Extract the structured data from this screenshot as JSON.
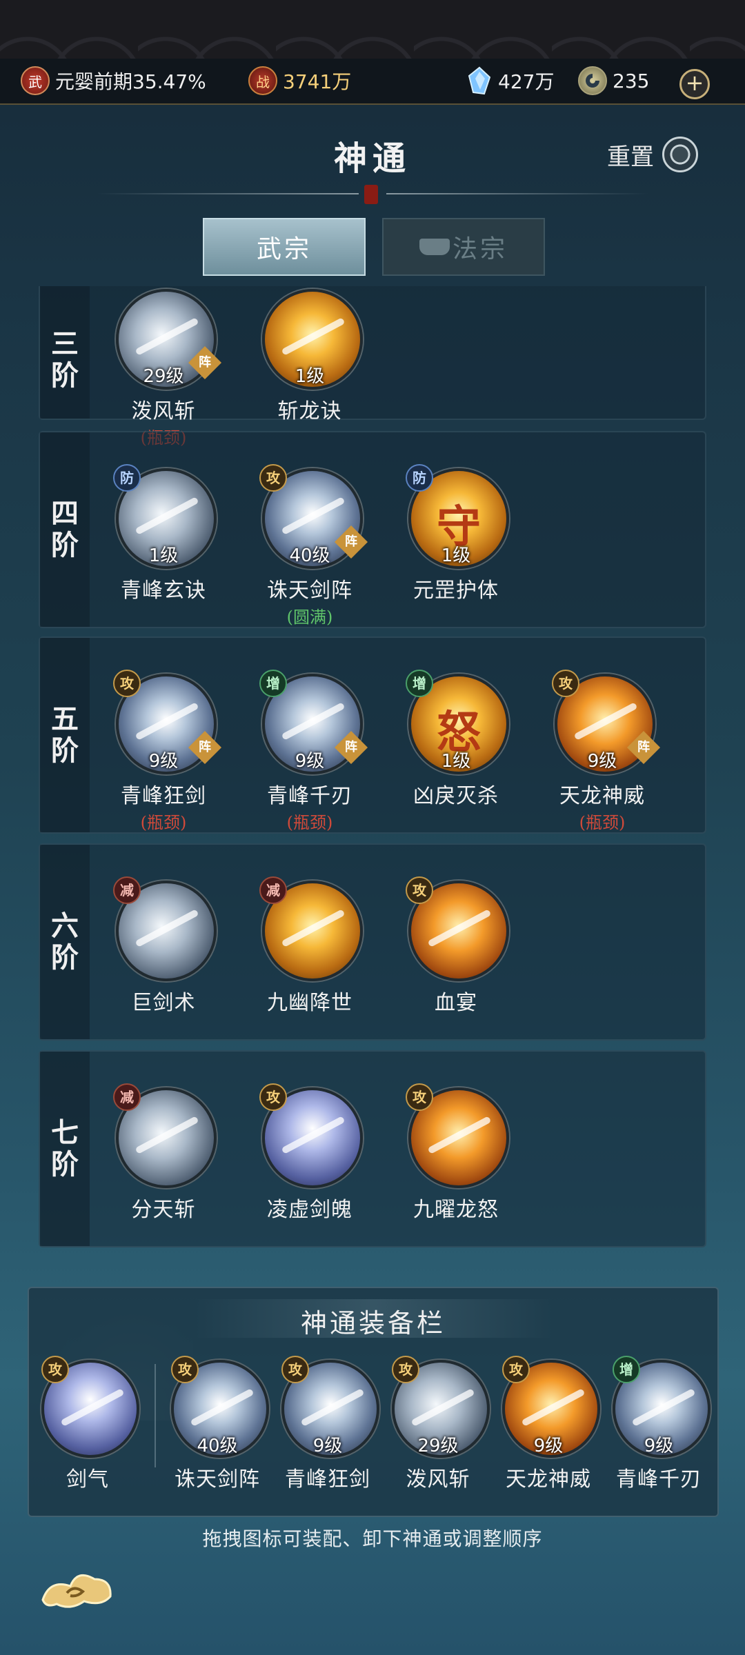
{
  "status": {
    "realm_icon": "武",
    "realm": "元婴前期35.47%",
    "power_icon": "战",
    "power": "3741万",
    "crystal": "427万",
    "coin": "235",
    "add": "+"
  },
  "header": {
    "title": "神通",
    "reset": "重置"
  },
  "tabs": [
    {
      "label": "武宗",
      "active": true
    },
    {
      "label": "法宗",
      "locked": true
    }
  ],
  "tiers": [
    {
      "label": "三阶",
      "skills": [
        {
          "name": "泼风斩",
          "level": "29级",
          "note": "(瓶颈)",
          "note_color": "red",
          "zhen": "阵",
          "style": "silver"
        },
        {
          "name": "斩龙诀",
          "level": "1级",
          "style": "gold"
        }
      ]
    },
    {
      "label": "四阶",
      "skills": [
        {
          "badge": "防",
          "name": "青峰玄诀",
          "level": "1级",
          "style": "silver"
        },
        {
          "badge": "攻",
          "name": "诛天剑阵",
          "level": "40级",
          "note": "(圆满)",
          "note_color": "green",
          "zhen": "阵",
          "style": "blue"
        },
        {
          "badge": "防",
          "name": "元罡护体",
          "level": "1级",
          "glyph": "守",
          "style": "gold"
        }
      ]
    },
    {
      "label": "五阶",
      "skills": [
        {
          "badge": "攻",
          "name": "青峰狂剑",
          "level": "9级",
          "note": "(瓶颈)",
          "note_color": "red",
          "zhen": "阵",
          "style": "blue"
        },
        {
          "badge": "增",
          "name": "青峰千刃",
          "level": "9级",
          "note": "(瓶颈)",
          "note_color": "red",
          "zhen": "阵",
          "style": "blue"
        },
        {
          "badge": "增",
          "name": "凶戾灭杀",
          "level": "1级",
          "glyph": "怒",
          "style": "gold"
        },
        {
          "badge": "攻",
          "name": "天龙神威",
          "level": "9级",
          "note": "(瓶颈)",
          "note_color": "red",
          "zhen": "阵",
          "style": "orange"
        }
      ]
    },
    {
      "label": "六阶",
      "skills": [
        {
          "badge": "减",
          "name": "巨剑术",
          "style": "silver"
        },
        {
          "badge": "减",
          "name": "九幽降世",
          "style": "gold"
        },
        {
          "badge": "攻",
          "name": "血宴",
          "style": "orange"
        }
      ]
    },
    {
      "label": "七阶",
      "skills": [
        {
          "badge": "减",
          "name": "分天斩",
          "style": "silver"
        },
        {
          "badge": "攻",
          "name": "凌虚剑魄",
          "style": "violet"
        },
        {
          "badge": "攻",
          "name": "九曜龙怒",
          "style": "orange"
        }
      ]
    }
  ],
  "equip": {
    "title": "神通装备栏",
    "slots": [
      {
        "badge": "攻",
        "name": "剑气",
        "style": "violet"
      },
      {
        "badge": "攻",
        "name": "诛天剑阵",
        "level": "40级",
        "style": "blue"
      },
      {
        "badge": "攻",
        "name": "青峰狂剑",
        "level": "9级",
        "style": "blue"
      },
      {
        "badge": "攻",
        "name": "泼风斩",
        "level": "29级",
        "style": "silver"
      },
      {
        "badge": "攻",
        "name": "天龙神威",
        "level": "9级",
        "style": "orange"
      },
      {
        "badge": "增",
        "name": "青峰千刃",
        "level": "9级",
        "style": "blue"
      }
    ],
    "hint": "拖拽图标可装配、卸下神通或调整顺序"
  },
  "colors": {
    "gold_text": "#f6d07a",
    "red_note": "#d04a3a",
    "green_note": "#5fc46a",
    "active_tab": "#a7c1cc"
  }
}
